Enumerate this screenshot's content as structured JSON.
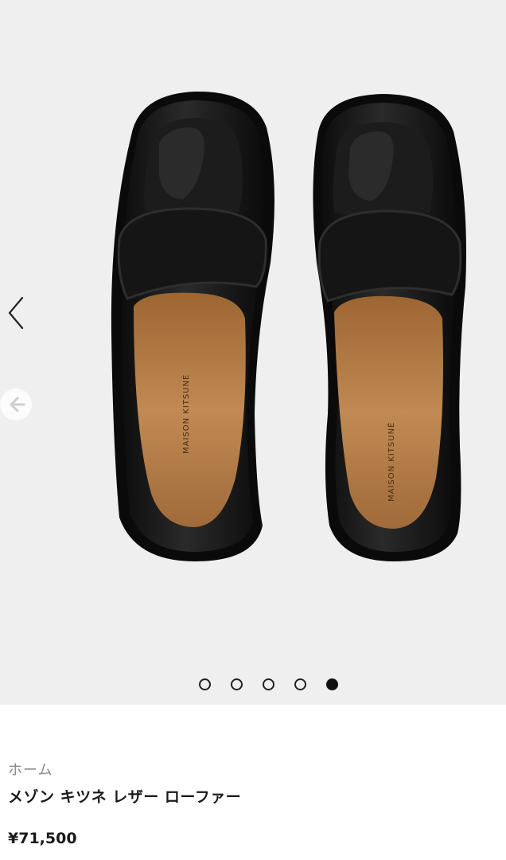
{
  "gallery": {
    "image": {
      "description_icon": "loafers-product-photo",
      "brand_insole_text": "MAISON KITSUNÉ"
    },
    "prev_arrow_icon": "chevron-left-icon",
    "prev_circle_icon": "arrow-left-circle-icon",
    "slides_total": 5,
    "active_slide": 5
  },
  "breadcrumb": {
    "home_label": "ホーム"
  },
  "product": {
    "title": "メゾン キツネ レザー ローファー",
    "price": "¥71,500"
  },
  "colors": {
    "gallery_bg": "#efefef",
    "shoe_black": "#141414",
    "insole_tan": "#b27a44"
  }
}
